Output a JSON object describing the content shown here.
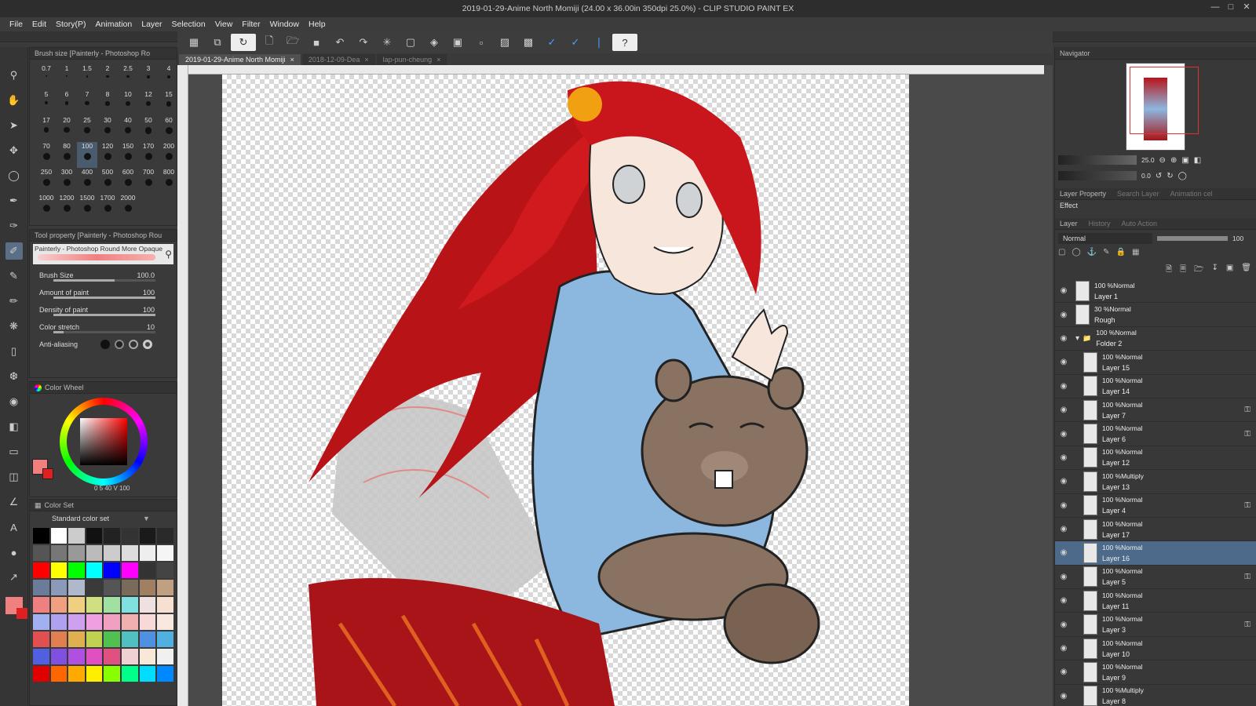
{
  "window": {
    "title": "2019-01-29-Anime North Momiji (24.00 x 36.00in 350dpi 25.0%) - CLIP STUDIO PAINT EX"
  },
  "menu": [
    "File",
    "Edit",
    "Story(P)",
    "Animation",
    "Layer",
    "Selection",
    "View",
    "Filter",
    "Window",
    "Help"
  ],
  "tabs": [
    "2019-01-29-Anime North Momiji",
    "2018-12-09-Dea",
    "lap-pun-cheung"
  ],
  "brush_size_panel": {
    "title": "Brush size [Painterly - Photoshop Ro",
    "sizes": [
      "0.7",
      "1",
      "1.5",
      "2",
      "2.5",
      "3",
      "4",
      "5",
      "6",
      "7",
      "8",
      "10",
      "12",
      "15",
      "17",
      "20",
      "25",
      "30",
      "40",
      "50",
      "60",
      "70",
      "80",
      "100",
      "120",
      "150",
      "170",
      "200",
      "250",
      "300",
      "400",
      "500",
      "600",
      "700",
      "800",
      "1000",
      "1200",
      "1500",
      "1700",
      "2000"
    ],
    "selected": "100"
  },
  "tool_property": {
    "title": "Tool property [Painterly - Photoshop Rou",
    "brush_name": "Painterly - Photoshop Round More Opaque",
    "brush_size_label": "Brush Size",
    "brush_size_value": "100.0",
    "brush_size_fraction": 0.6,
    "amount_label": "Amount of paint",
    "amount_value": "100",
    "amount_fraction": 1.0,
    "density_label": "Density of paint",
    "density_value": "100",
    "density_fraction": 1.0,
    "stretch_label": "Color stretch",
    "stretch_value": "10",
    "stretch_fraction": 0.1,
    "antialias_label": "Anti-aliasing"
  },
  "color_wheel": {
    "title": "Color Wheel",
    "readout": "0   5   40   V  100",
    "main_color": "#f08080",
    "sub_color": "#e02020"
  },
  "color_set": {
    "title": "Color Set",
    "set_name": "Standard color set",
    "swatches": [
      "#000000",
      "#ffffff",
      "#cccccc",
      "#111111",
      "#222222",
      "#333333",
      "#1a1a1a",
      "#2a2a2a",
      "#555555",
      "#777777",
      "#999999",
      "#bbbbbb",
      "#cccccc",
      "#dddddd",
      "#eeeeee",
      "#f5f5f5",
      "#ff0000",
      "#ffff00",
      "#00ff00",
      "#00ffff",
      "#0000ff",
      "#ff00ff",
      "#333333",
      "#444444",
      "#6b7b9a",
      "#8a9ab8",
      "#b0b8cc",
      "#3a3a3a",
      "#555555",
      "#7a6a5a",
      "#a08060",
      "#c0a080",
      "#f08080",
      "#f0a080",
      "#f0d080",
      "#d0e080",
      "#a0e0a0",
      "#80e0e0",
      "#f0e0e0",
      "#f8e0d0",
      "#a0b0f0",
      "#b0a0f0",
      "#d0a0f0",
      "#f0a0e0",
      "#f0a0c0",
      "#f0b0b0",
      "#f8d8d8",
      "#f8e8e0",
      "#e05050",
      "#e08050",
      "#e0b050",
      "#c0d050",
      "#50c050",
      "#50c0c0",
      "#5090e0",
      "#50b0e0",
      "#5060e0",
      "#8050e0",
      "#b050e0",
      "#e050c0",
      "#e05080",
      "#f0d0d0",
      "#f8e8d8",
      "#f0f0f0",
      "#e00000",
      "#ff6600",
      "#ffaa00",
      "#ffee00",
      "#88ff00",
      "#00ff88",
      "#00ddff",
      "#0088ff"
    ]
  },
  "navigator": {
    "title": "Navigator",
    "zoom": "25.0",
    "angle": "0.0"
  },
  "layer_property": {
    "tabs": [
      "Layer Property",
      "Search Layer",
      "Animation cel"
    ],
    "effect_label": "Effect"
  },
  "layer_panel": {
    "tabs": [
      "Layer",
      "History",
      "Auto Action"
    ],
    "blend_mode": "Normal",
    "opacity": "100",
    "layers": [
      {
        "blend": "100 %Normal",
        "name": "Layer 1",
        "lock": false,
        "sel": false,
        "indent": 0
      },
      {
        "blend": "30 %Normal",
        "name": "Rough",
        "lock": false,
        "sel": false,
        "indent": 0
      },
      {
        "blend": "100 %Normal",
        "name": "Folder 2",
        "lock": false,
        "sel": false,
        "indent": 0,
        "folder": true
      },
      {
        "blend": "100 %Normal",
        "name": "Layer 15",
        "lock": false,
        "sel": false,
        "indent": 1
      },
      {
        "blend": "100 %Normal",
        "name": "Layer 14",
        "lock": false,
        "sel": false,
        "indent": 1
      },
      {
        "blend": "100 %Normal",
        "name": "Layer 7",
        "lock": true,
        "sel": false,
        "indent": 1
      },
      {
        "blend": "100 %Normal",
        "name": "Layer 6",
        "lock": true,
        "sel": false,
        "indent": 1
      },
      {
        "blend": "100 %Normal",
        "name": "Layer 12",
        "lock": false,
        "sel": false,
        "indent": 1
      },
      {
        "blend": "100 %Multiply",
        "name": "Layer 13",
        "lock": false,
        "sel": false,
        "indent": 1
      },
      {
        "blend": "100 %Normal",
        "name": "Layer 4",
        "lock": true,
        "sel": false,
        "indent": 1
      },
      {
        "blend": "100 %Normal",
        "name": "Layer 17",
        "lock": false,
        "sel": false,
        "indent": 1
      },
      {
        "blend": "100 %Normal",
        "name": "Layer 16",
        "lock": false,
        "sel": true,
        "indent": 1
      },
      {
        "blend": "100 %Normal",
        "name": "Layer 5",
        "lock": true,
        "sel": false,
        "indent": 1
      },
      {
        "blend": "100 %Normal",
        "name": "Layer 11",
        "lock": false,
        "sel": false,
        "indent": 1
      },
      {
        "blend": "100 %Normal",
        "name": "Layer 3",
        "lock": true,
        "sel": false,
        "indent": 1
      },
      {
        "blend": "100 %Normal",
        "name": "Layer 10",
        "lock": false,
        "sel": false,
        "indent": 1
      },
      {
        "blend": "100 %Normal",
        "name": "Layer 9",
        "lock": false,
        "sel": false,
        "indent": 1
      },
      {
        "blend": "100 %Multiply",
        "name": "Layer 8",
        "lock": false,
        "sel": false,
        "indent": 1
      }
    ]
  },
  "status": {
    "zoom": "25.0",
    "angle": "0.0"
  }
}
